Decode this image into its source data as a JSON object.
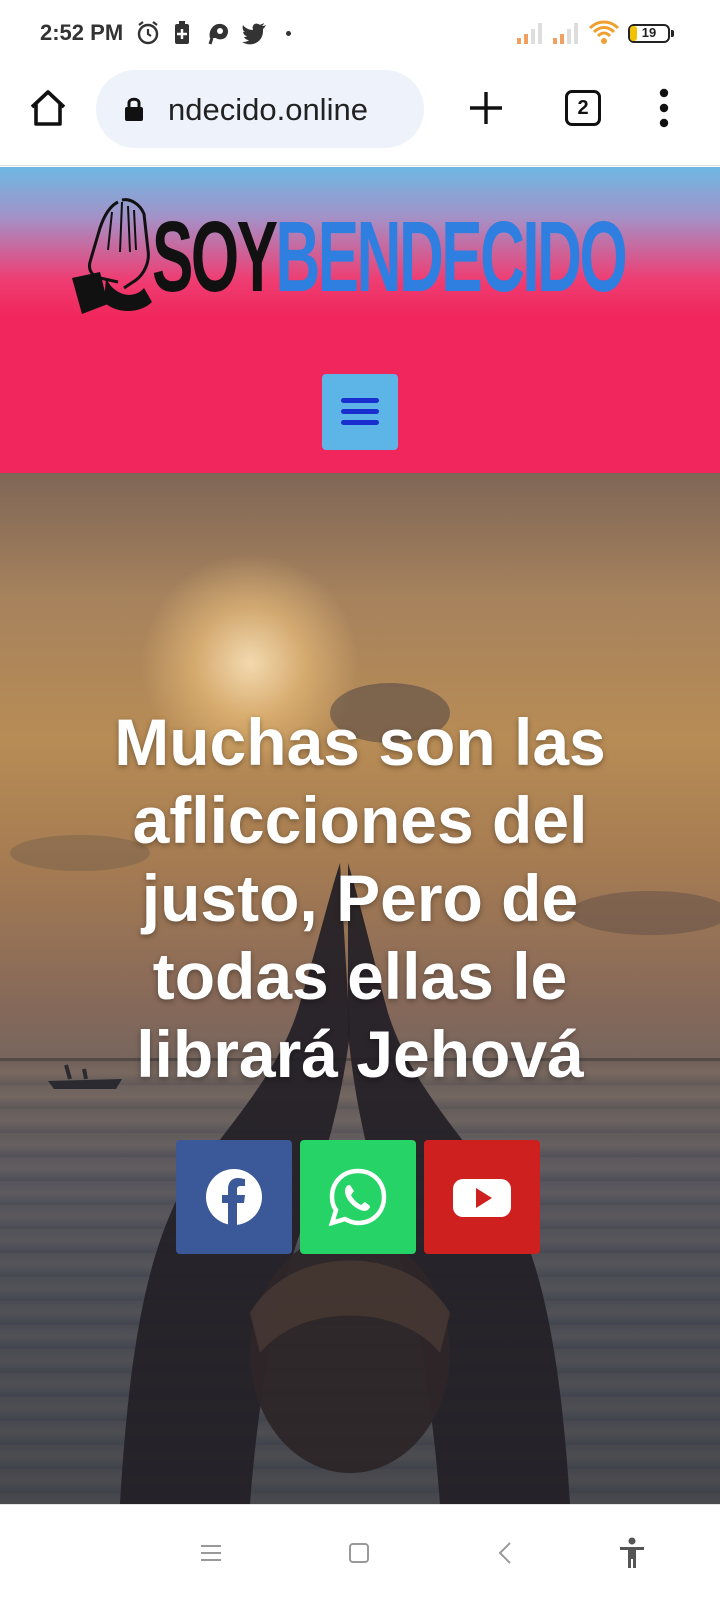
{
  "status_bar": {
    "time": "2:52 PM",
    "battery_level": "19",
    "icons": [
      "alarm-icon",
      "battery-saver-icon",
      "app-notification-icon",
      "twitter-icon",
      "signal-icon",
      "signal-icon",
      "wifi-icon",
      "battery-icon"
    ]
  },
  "browser": {
    "url": "ndecido.online",
    "tab_count": "2",
    "icons": [
      "home-icon",
      "lock-icon",
      "plus-icon",
      "tabs-icon",
      "more-vert-icon"
    ]
  },
  "site": {
    "logo": {
      "part1": "SOY",
      "part2": "BENDECIDO",
      "colors": {
        "part1": "#111111",
        "part2": "#2f7fe0"
      }
    },
    "header_colors": {
      "top": "#6db8e3",
      "main": "#f1265c",
      "menu_button": "#5db4e6"
    },
    "hero": {
      "title": "Muchas son las aflicciones del justo, Pero de todas ellas le librará Jehová"
    },
    "social": [
      {
        "name": "facebook",
        "icon": "facebook-icon",
        "color": "#3b5998"
      },
      {
        "name": "whatsapp",
        "icon": "whatsapp-icon",
        "color": "#25d366"
      },
      {
        "name": "youtube",
        "icon": "youtube-icon",
        "color": "#cd201f"
      }
    ]
  },
  "nav_bar": {
    "icons": [
      "menu-icon",
      "home-square-icon",
      "back-icon",
      "accessibility-icon"
    ]
  }
}
